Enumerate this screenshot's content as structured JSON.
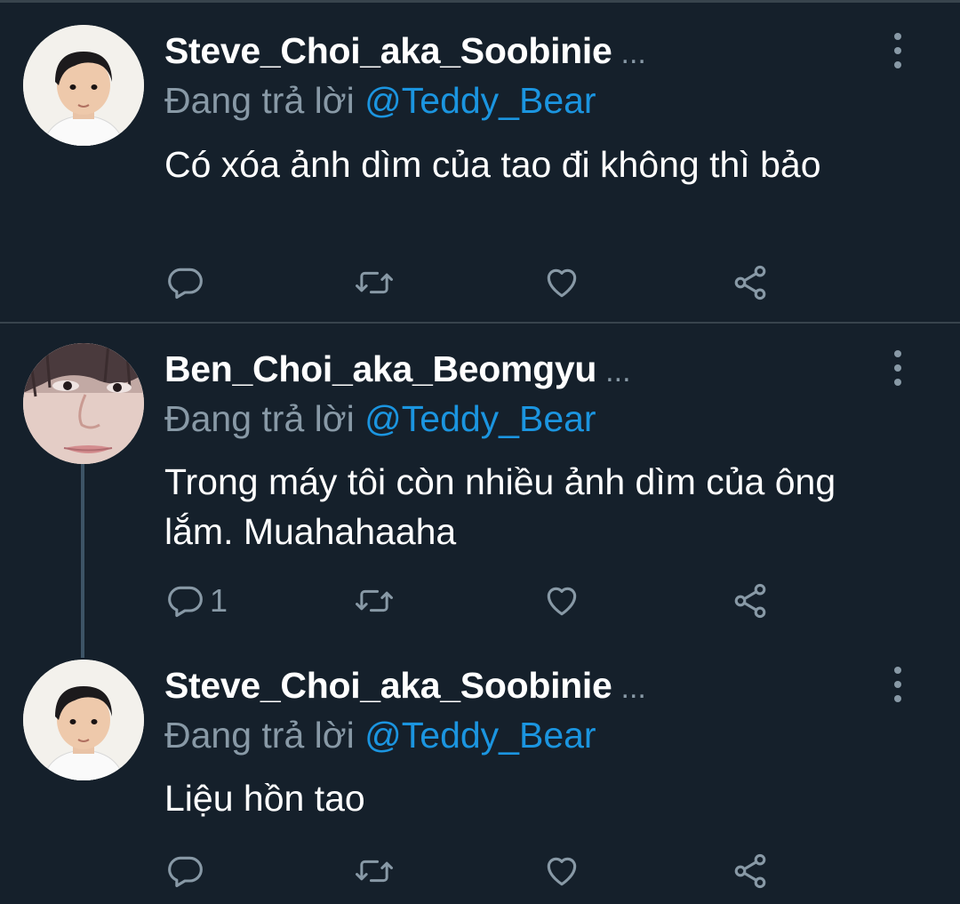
{
  "reply_prefix": "Đang trả lời",
  "tweets": [
    {
      "author": "Steve_Choi_aka_Soobinie",
      "ellipsis": "...",
      "mention": "@Teddy_Bear",
      "text": "Có xóa ảnh dìm của tao đi không thì bảo",
      "reply_count": "",
      "avatar": "child-boy-avatar"
    },
    {
      "author": "Ben_Choi_aka_Beomgyu",
      "ellipsis": "...",
      "mention": "@Teddy_Bear",
      "text": "Trong máy tôi còn nhiều ảnh dìm của ông lắm. Muahahaaha",
      "reply_count": "1",
      "avatar": "closeup-face-avatar"
    },
    {
      "author": "Steve_Choi_aka_Soobinie",
      "ellipsis": "...",
      "mention": "@Teddy_Bear",
      "text": "Liệu hồn tao",
      "reply_count": "",
      "avatar": "child-boy-avatar"
    }
  ],
  "icons": {
    "reply": "reply-icon",
    "retweet": "retweet-icon",
    "like": "like-icon",
    "share": "share-icon",
    "more": "more-vertical-icon"
  },
  "colors": {
    "background": "#15202b",
    "text": "#ffffff",
    "secondary": "#8899a6",
    "mention": "#1b95e0",
    "divider": "#38444d"
  }
}
